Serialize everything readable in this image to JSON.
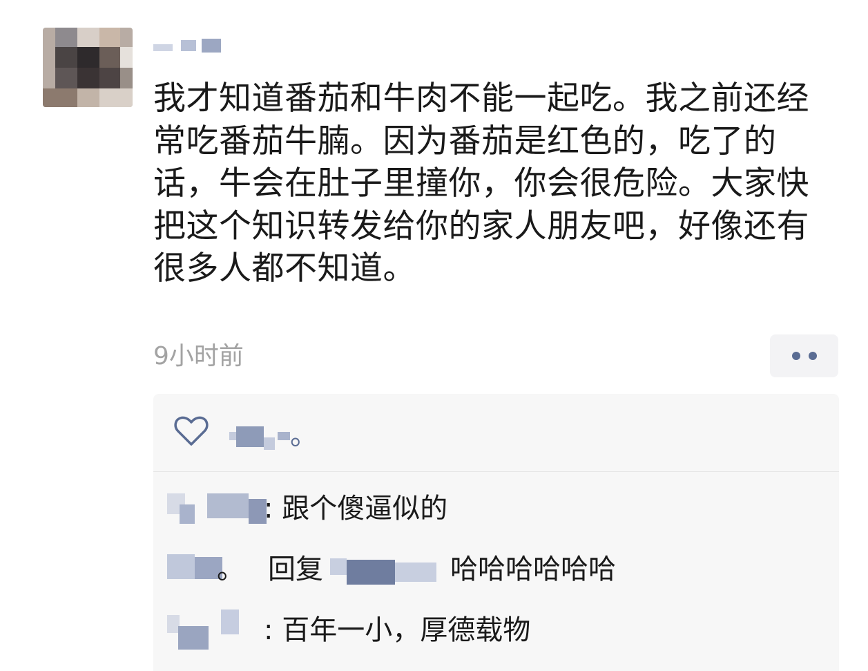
{
  "post": {
    "text": "我才知道番茄和牛肉不能一起吃。我之前还经常吃番茄牛腩。因为番茄是红色的，吃了的话，牛会在肚子里撞你，你会很危险。大家快把这个知识转发给你的家人朋友吧，好像还有很多人都不知道。",
    "time": "9小时前"
  },
  "colors": {
    "link_blue": "#5a6c93",
    "muted_gray": "#a3a3a3",
    "panel_bg": "#f7f7f7"
  },
  "icons": {
    "like": "heart-outline-icon",
    "more": "two-dots-icon"
  },
  "likes": {
    "suffix": "。"
  },
  "comments": [
    {
      "text": ": 跟个傻逼似的"
    },
    {
      "prefix": "。",
      "reply_word": "回复",
      "text": "哈哈哈哈哈哈"
    },
    {
      "text": ": 百年一小，厚德载物"
    }
  ]
}
